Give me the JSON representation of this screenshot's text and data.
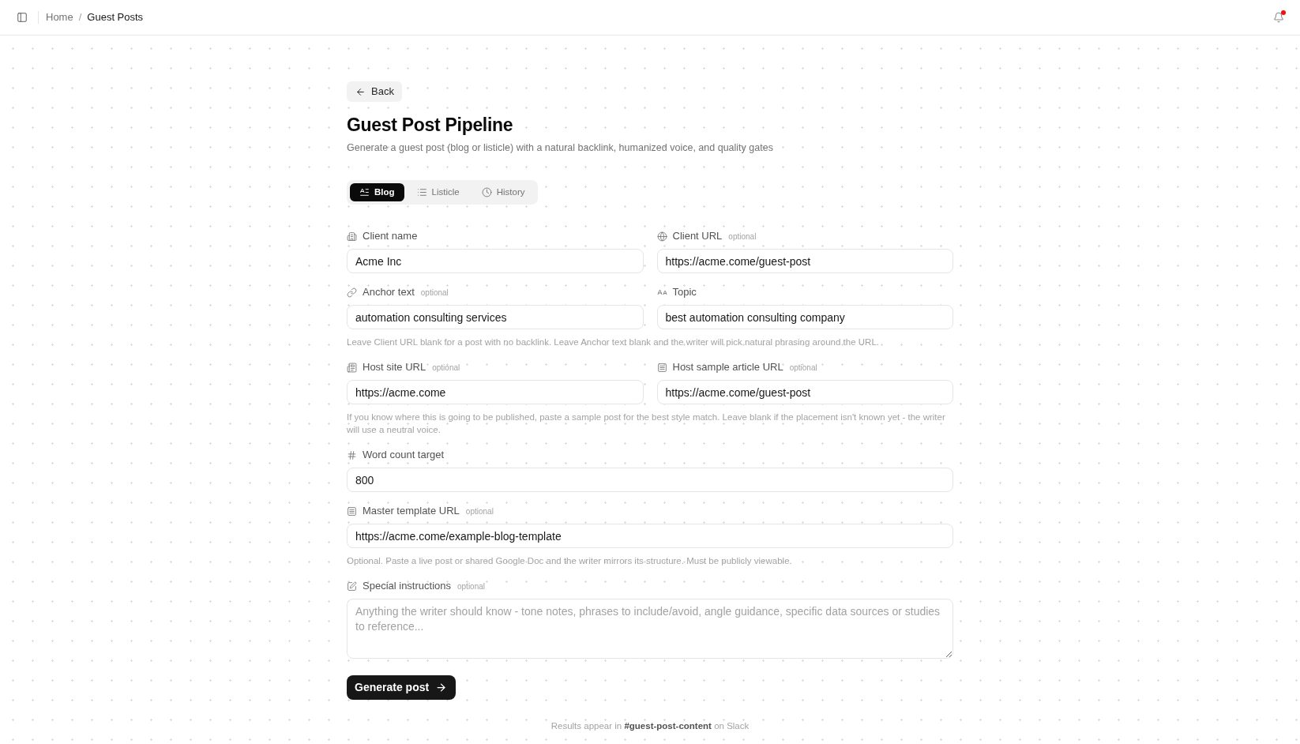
{
  "topbar": {
    "breadcrumbs": [
      {
        "label": "Home",
        "current": false
      },
      {
        "label": "Guest Posts",
        "current": true
      }
    ],
    "separator": "/",
    "notifications": {
      "unread": true
    }
  },
  "back_button": {
    "label": "Back"
  },
  "header": {
    "title": "Guest Post Pipeline",
    "subtitle": "Generate a guest post (blog or listicle) with a natural backlink, humanized voice, and quality gates"
  },
  "tabs": [
    {
      "label": "Blog",
      "selected": true
    },
    {
      "label": "Listicle",
      "selected": false
    },
    {
      "label": "History",
      "selected": false
    }
  ],
  "form": {
    "sections": [
      {
        "fields": [
          {
            "kind": "input",
            "label": "Client name",
            "value": "Acme Inc"
          },
          {
            "kind": "input",
            "label": "Client URL",
            "tag": "optional",
            "value": "https://acme.come/guest-post"
          }
        ]
      },
      {
        "fields": [
          {
            "kind": "input",
            "label": "Anchor text",
            "tag": "optional",
            "value": "automation consulting services"
          },
          {
            "kind": "input",
            "label": "Topic",
            "value": "best automation consulting company"
          }
        ],
        "hint": "Leave Client URL blank for a post with no backlink. Leave Anchor text blank and the writer will pick natural phrasing around the URL."
      },
      {
        "fields": [
          {
            "kind": "input",
            "label": "Host site URL",
            "tag": "optional",
            "value": "https://acme.come"
          },
          {
            "kind": "input",
            "label": "Host sample article URL",
            "tag": "optional",
            "value": "https://acme.come/guest-post"
          }
        ],
        "hint": "If you know where this is going to be published, paste a sample post for the best style match. Leave blank if the placement isn't known yet - the writer will use a neutral voice."
      },
      {
        "fields": [
          {
            "kind": "input",
            "label": "Word count target",
            "value": "800"
          }
        ]
      },
      {
        "fields": [
          {
            "kind": "input",
            "label": "Master template URL",
            "tag": "optional",
            "value": "https://acme.come/example-blog-template"
          }
        ],
        "hint": "Optional. Paste a live post or shared Google Doc and the writer mirrors its structure. Must be publicly viewable."
      },
      {
        "fields": [
          {
            "kind": "textarea",
            "label": "Special instructions",
            "tag": "optional",
            "placeholder": "Anything the writer should know - tone notes, phrases to include/avoid, angle guidance, specific data sources or studies to reference..."
          }
        ]
      }
    ]
  },
  "submit_button": {
    "label": "Generate post"
  },
  "footer_note": "Results appear in **#guest-post-content** on Slack"
}
